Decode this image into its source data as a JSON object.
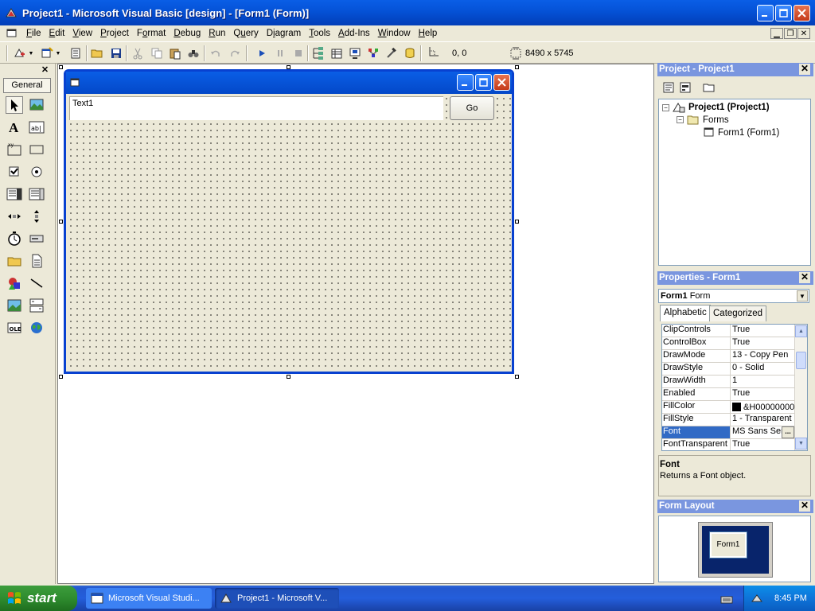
{
  "window": {
    "title": "Project1 - Microsoft Visual Basic [design] - [Form1 (Form)]"
  },
  "menu": [
    {
      "pre": "",
      "u": "F",
      "post": "ile"
    },
    {
      "pre": "",
      "u": "E",
      "post": "dit"
    },
    {
      "pre": "",
      "u": "V",
      "post": "iew"
    },
    {
      "pre": "",
      "u": "P",
      "post": "roject"
    },
    {
      "pre": "F",
      "u": "o",
      "post": "rmat"
    },
    {
      "pre": "",
      "u": "D",
      "post": "ebug"
    },
    {
      "pre": "",
      "u": "R",
      "post": "un"
    },
    {
      "pre": "Q",
      "u": "u",
      "post": "ery"
    },
    {
      "pre": "D",
      "u": "i",
      "post": "agram"
    },
    {
      "pre": "",
      "u": "T",
      "post": "ools"
    },
    {
      "pre": "",
      "u": "A",
      "post": "dd-Ins"
    },
    {
      "pre": "",
      "u": "W",
      "post": "indow"
    },
    {
      "pre": "",
      "u": "H",
      "post": "elp"
    }
  ],
  "toolbar": {
    "position": "0, 0",
    "size": "8490 x 5745"
  },
  "toolbox": {
    "tab": "General"
  },
  "form": {
    "textbox_text": "Text1",
    "button_caption": "Go"
  },
  "project_panel": {
    "title": "Project - Project1",
    "root": "Project1 (Project1)",
    "folder": "Forms",
    "form_item": "Form1 (Form1)"
  },
  "properties_panel": {
    "title": "Properties - Form1",
    "object_name": "Form1",
    "object_type": "Form",
    "tab_alphabetic": "Alphabetic",
    "tab_categorized": "Categorized",
    "rows": [
      {
        "name": "ClipControls",
        "value": "True"
      },
      {
        "name": "ControlBox",
        "value": "True"
      },
      {
        "name": "DrawMode",
        "value": "13 - Copy Pen"
      },
      {
        "name": "DrawStyle",
        "value": "0 - Solid"
      },
      {
        "name": "DrawWidth",
        "value": "1"
      },
      {
        "name": "Enabled",
        "value": "True"
      },
      {
        "name": "FillColor",
        "value": "&H00000000"
      },
      {
        "name": "FillStyle",
        "value": "1 - Transparent"
      },
      {
        "name": "Font",
        "value": "MS Sans Serif"
      },
      {
        "name": "FontTransparent",
        "value": "True"
      }
    ],
    "selected_property": "Font",
    "description_title": "Font",
    "description_text": "Returns a Font object."
  },
  "layout_panel": {
    "title": "Form Layout",
    "form_label": "Form1"
  },
  "taskbar": {
    "start_label": "start",
    "tasks": [
      "Microsoft Visual Studi...",
      "Project1 - Microsoft V..."
    ],
    "clock": "8:45 PM"
  },
  "colors": {
    "title_blue": "#0553d8",
    "panel_title": "#7a96df",
    "selection": "#316ac5",
    "start_green": "#2f8c2f"
  }
}
